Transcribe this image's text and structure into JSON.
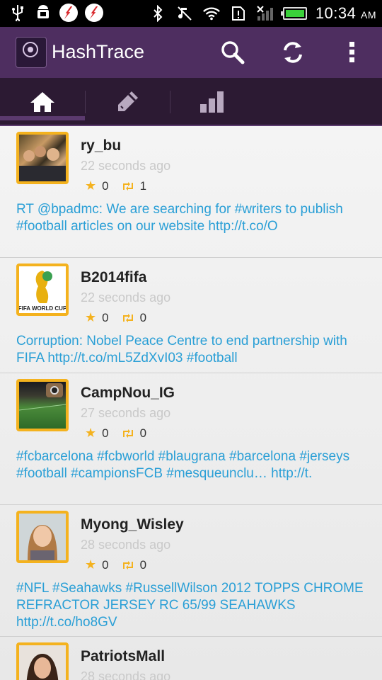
{
  "app": {
    "title": "HashTrace"
  },
  "status_bar": {
    "time": "10:34",
    "ampm": "AM"
  },
  "colors": {
    "appbar": "#4e2e60",
    "tabs": "#2c1a33",
    "accent_orange": "#f4b21e",
    "link": "#2a9fd6"
  },
  "tabs": [
    {
      "icon": "home-icon"
    },
    {
      "icon": "edit-icon"
    },
    {
      "icon": "stats-icon"
    }
  ],
  "feed": [
    {
      "user": "ry_bu",
      "ago": "22 seconds ago",
      "favorites": "0",
      "retweets": "1",
      "text": "RT @bpadmc: We are searching for #writers to publish #football articles on our website http://t.co/O"
    },
    {
      "user": "B2014fifa",
      "ago": "22 seconds ago",
      "favorites": "0",
      "retweets": "0",
      "text": "Corruption: Nobel Peace Centre to end partnership with FIFA http://t.co/mL5ZdXvI03 #football",
      "avatar_caption": "FIFA WORLD CUP"
    },
    {
      "user": "CampNou_IG",
      "ago": "27 seconds ago",
      "favorites": "0",
      "retweets": "0",
      "text": "#fcbarcelona #fcbworld #blaugrana #barcelona #jerseys #football #campionsFCB #mesqueunclu… http://t."
    },
    {
      "user": "Myong_Wisley",
      "ago": "28 seconds ago",
      "favorites": "0",
      "retweets": "0",
      "text": "#NFL #Seahawks #RussellWilson 2012 TOPPS CHROME REFRACTOR JERSEY RC 65/99 SEAHAWKS http://t.co/ho8GV"
    },
    {
      "user": "PatriotsMall",
      "ago": "28 seconds ago"
    }
  ]
}
